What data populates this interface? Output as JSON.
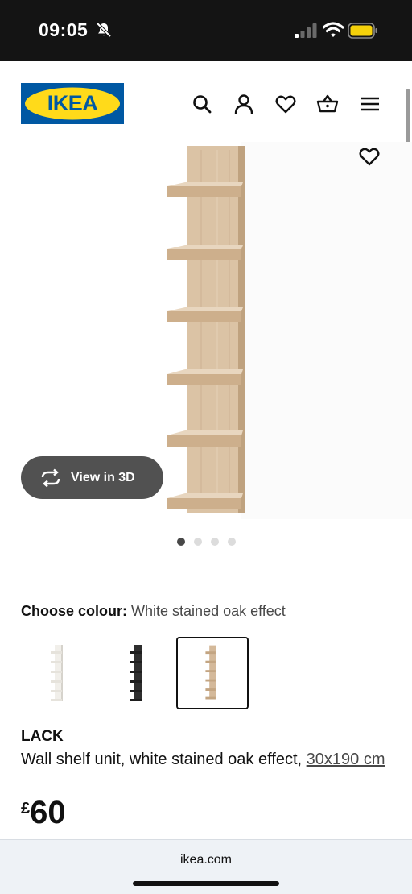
{
  "status": {
    "time": "09:05",
    "icons": [
      "bell-slash-icon",
      "cellular-signal-icon",
      "wifi-icon",
      "battery-icon"
    ],
    "battery_color": "#F5D10A"
  },
  "header": {
    "logo_text": "IKEA",
    "logo_colors": {
      "blue": "#0058A3",
      "yellow": "#FFDA1A"
    },
    "icons": [
      "search-icon",
      "account-icon",
      "favourites-heart-icon",
      "shopping-basket-icon",
      "menu-icon"
    ]
  },
  "gallery": {
    "view_3d_label": "View in 3D",
    "favourite_icon": "heart-outline-icon",
    "image_count": 4,
    "active_image": 1
  },
  "colour": {
    "label": "Choose colour:",
    "selected": "White stained oak effect",
    "options": [
      {
        "name": "white",
        "hex": "#F1EFEA"
      },
      {
        "name": "black-brown",
        "hex": "#2E2E2E"
      },
      {
        "name": "white stained oak effect",
        "hex": "#D4B99A",
        "selected": true
      }
    ]
  },
  "product": {
    "name": "LACK",
    "description": "Wall shelf unit, white stained oak effect, ",
    "size": "30x190 cm",
    "currency": "£",
    "price": "60"
  },
  "browser": {
    "url": "ikea.com"
  }
}
